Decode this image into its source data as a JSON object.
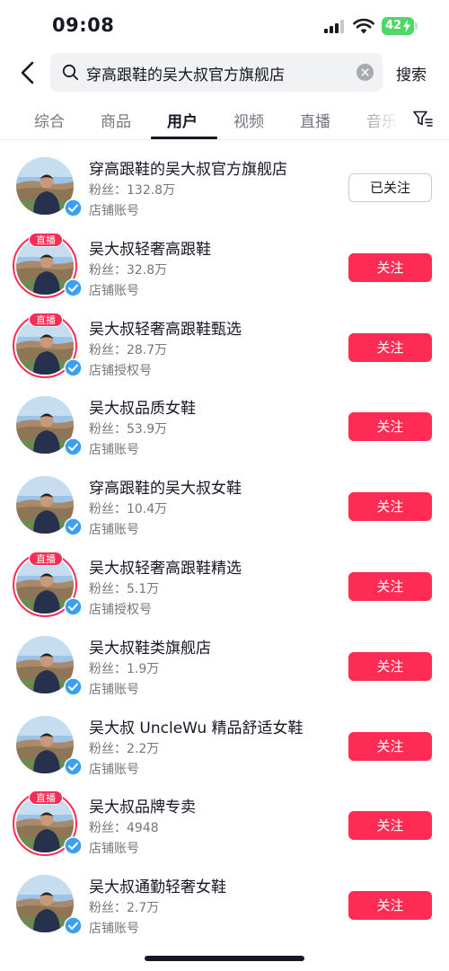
{
  "status_bar": {
    "time": "09:08",
    "battery": "42"
  },
  "search": {
    "query": "穿高跟鞋的吴大叔官方旗舰店",
    "button_label": "搜索"
  },
  "tabs": [
    {
      "label": "综合"
    },
    {
      "label": "商品"
    },
    {
      "label": "用户"
    },
    {
      "label": "视频"
    },
    {
      "label": "直播"
    },
    {
      "label": "音乐"
    }
  ],
  "active_tab": "用户",
  "live_badge_label": "直播",
  "users": [
    {
      "name": "穿高跟鞋的吴大叔官方旗舰店",
      "fans": "粉丝：132.8万",
      "type": "店铺账号",
      "follow_label": "已关注",
      "followed": true,
      "live": false
    },
    {
      "name": "吴大叔轻奢高跟鞋",
      "fans": "粉丝：32.8万",
      "type": "店铺账号",
      "follow_label": "关注",
      "followed": false,
      "live": true
    },
    {
      "name": "吴大叔轻奢高跟鞋甄选",
      "fans": "粉丝：28.7万",
      "type": "店铺授权号",
      "follow_label": "关注",
      "followed": false,
      "live": true
    },
    {
      "name": "吴大叔品质女鞋",
      "fans": "粉丝：53.9万",
      "type": "店铺账号",
      "follow_label": "关注",
      "followed": false,
      "live": false
    },
    {
      "name": "穿高跟鞋的吴大叔女鞋",
      "fans": "粉丝：10.4万",
      "type": "店铺账号",
      "follow_label": "关注",
      "followed": false,
      "live": false
    },
    {
      "name": "吴大叔轻奢高跟鞋精选",
      "fans": "粉丝：5.1万",
      "type": "店铺授权号",
      "follow_label": "关注",
      "followed": false,
      "live": true
    },
    {
      "name": "吴大叔鞋类旗舰店",
      "fans": "粉丝：1.9万",
      "type": "店铺账号",
      "follow_label": "关注",
      "followed": false,
      "live": false
    },
    {
      "name": "吴大叔 UncleWu 精品舒适女鞋",
      "fans": "粉丝：2.2万",
      "type": "店铺账号",
      "follow_label": "关注",
      "followed": false,
      "live": false
    },
    {
      "name": "吴大叔品牌专卖",
      "fans": "粉丝：4948",
      "type": "店铺账号",
      "follow_label": "关注",
      "followed": false,
      "live": true
    },
    {
      "name": "吴大叔通勤轻奢女鞋",
      "fans": "粉丝：2.7万",
      "type": "店铺账号",
      "follow_label": "关注",
      "followed": false,
      "live": false
    }
  ],
  "colors": {
    "accent": "#fe2c55",
    "verified": "#3aa0f5",
    "battery": "#4cd964",
    "secondary_text": "#75777f"
  }
}
